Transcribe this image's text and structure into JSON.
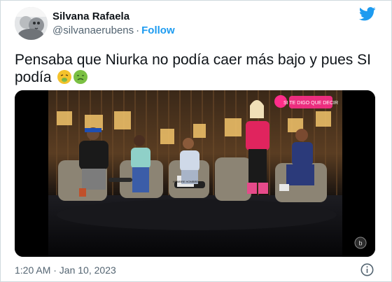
{
  "author": {
    "name": "Silvana Rafaela",
    "handle": "@silvanaerubens",
    "separator": "·",
    "follow_label": "Follow"
  },
  "tweet": {
    "text": "Pensaba que Niurka no podía caer más bajo y pues SI podía",
    "emojis": [
      "vomiting-face-emoji",
      "nauseated-face-emoji"
    ]
  },
  "media": {
    "type": "video",
    "show_logo_text": "SI TE DIGO QUE DECIR",
    "table_sign_text": "HOMBRE HOMBRE",
    "corner_badge": "b"
  },
  "footer": {
    "timestamp": "1:20 AM · Jan 10, 2023"
  },
  "colors": {
    "accent": "#1d9bf0",
    "text": "#0f1419",
    "secondary_text": "#536471",
    "border": "#cfd9de"
  },
  "icons": {
    "brand": "twitter-bird-icon",
    "info": "info-circle-icon"
  }
}
